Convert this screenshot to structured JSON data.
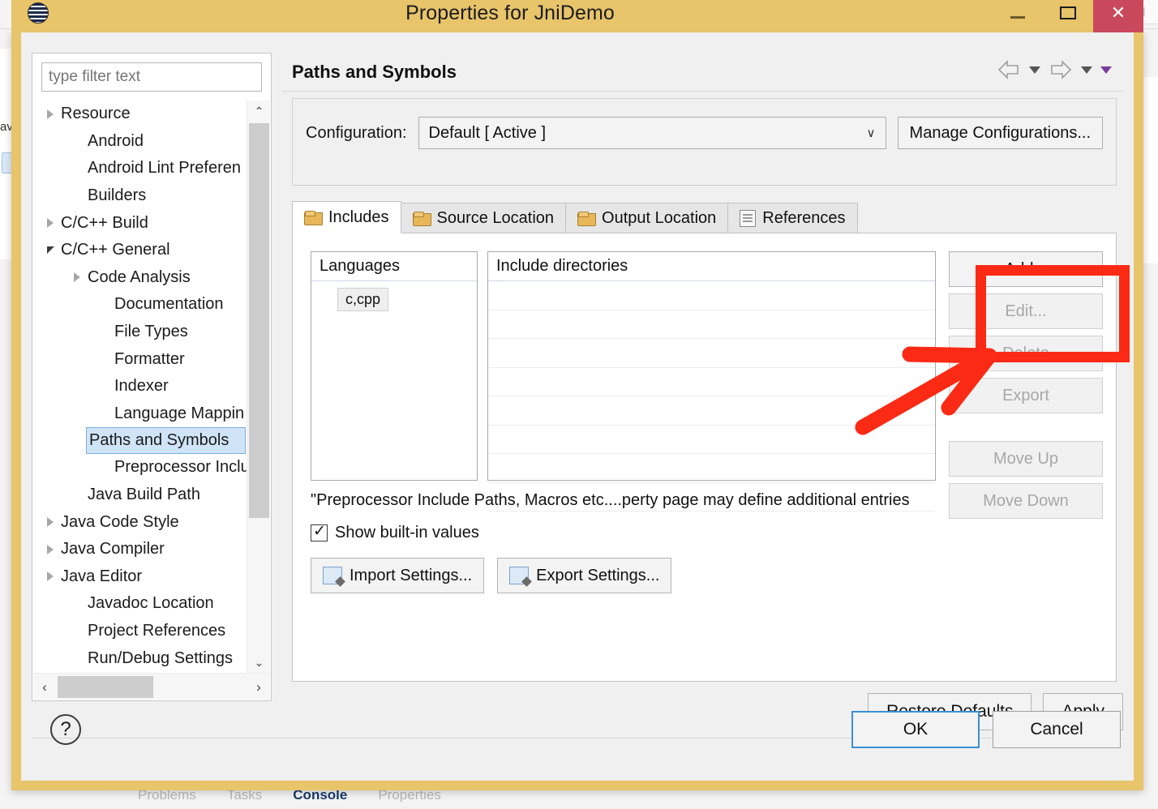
{
  "background": {
    "tool_icons": [
      "pen-icon",
      "chevron-down-icon",
      "device-icon",
      "add-perspective-icon"
    ],
    "left_tab_text": "av",
    "bottom_tabs": [
      {
        "label": "Problems",
        "icon": "problems-icon",
        "active": false
      },
      {
        "label": "Tasks",
        "icon": "tasks-icon",
        "active": false
      },
      {
        "label": "Console",
        "icon": "console-icon",
        "active": true,
        "suffix": "×"
      },
      {
        "label": "Properties",
        "icon": "properties-icon",
        "active": false
      }
    ]
  },
  "window": {
    "title": "Properties for JniDemo",
    "icon": "eclipse-icon",
    "minimize_label": "–",
    "maximize_label": "□",
    "close_label": "✕"
  },
  "sidebar": {
    "filter_placeholder": "type filter text",
    "filter_value": "",
    "items": [
      {
        "label": "Resource",
        "indent": 0,
        "twisty": "collapsed",
        "selected": false
      },
      {
        "label": "Android",
        "indent": 1,
        "twisty": "none",
        "selected": false
      },
      {
        "label": "Android Lint Preferen",
        "indent": 1,
        "twisty": "none",
        "selected": false
      },
      {
        "label": "Builders",
        "indent": 1,
        "twisty": "none",
        "selected": false
      },
      {
        "label": "C/C++ Build",
        "indent": 0,
        "twisty": "collapsed",
        "selected": false
      },
      {
        "label": "C/C++ General",
        "indent": 0,
        "twisty": "expanded",
        "selected": false
      },
      {
        "label": "Code Analysis",
        "indent": 1,
        "twisty": "collapsed",
        "selected": false
      },
      {
        "label": "Documentation",
        "indent": 2,
        "twisty": "none",
        "selected": false
      },
      {
        "label": "File Types",
        "indent": 2,
        "twisty": "none",
        "selected": false
      },
      {
        "label": "Formatter",
        "indent": 2,
        "twisty": "none",
        "selected": false
      },
      {
        "label": "Indexer",
        "indent": 2,
        "twisty": "none",
        "selected": false
      },
      {
        "label": "Language Mappin",
        "indent": 2,
        "twisty": "none",
        "selected": false
      },
      {
        "label": "Paths and Symbols",
        "indent": 2,
        "twisty": "none",
        "selected": true
      },
      {
        "label": "Preprocessor Inclu",
        "indent": 2,
        "twisty": "none",
        "selected": false
      },
      {
        "label": "Java Build Path",
        "indent": 1,
        "twisty": "none",
        "selected": false
      },
      {
        "label": "Java Code Style",
        "indent": 0,
        "twisty": "collapsed",
        "selected": false
      },
      {
        "label": "Java Compiler",
        "indent": 0,
        "twisty": "collapsed",
        "selected": false
      },
      {
        "label": "Java Editor",
        "indent": 0,
        "twisty": "collapsed",
        "selected": false
      },
      {
        "label": "Javadoc Location",
        "indent": 1,
        "twisty": "none",
        "selected": false
      },
      {
        "label": "Project References",
        "indent": 1,
        "twisty": "none",
        "selected": false
      },
      {
        "label": "Run/Debug Settings",
        "indent": 1,
        "twisty": "none",
        "selected": false
      }
    ],
    "scroll_up_glyph": "⌃",
    "scroll_down_glyph": "⌄",
    "scroll_left_glyph": "‹",
    "scroll_right_glyph": "›"
  },
  "page": {
    "title": "Paths and Symbols",
    "nav": {
      "back_icon": "back-arrow-icon",
      "back_menu_icon": "chevron-down-icon",
      "forward_icon": "forward-arrow-icon",
      "forward_menu_icon": "chevron-down-icon",
      "view_menu_icon": "view-menu-icon"
    }
  },
  "configuration": {
    "label": "Configuration:",
    "selected": "Default  [ Active ]",
    "caret": "∨",
    "manage_button": "Manage Configurations..."
  },
  "tabs": [
    {
      "label": "Includes",
      "icon": "includes-folder-icon",
      "active": true
    },
    {
      "label": "Source Location",
      "icon": "source-folder-icon",
      "active": false
    },
    {
      "label": "Output Location",
      "icon": "output-folder-icon",
      "active": false
    },
    {
      "label": "References",
      "icon": "references-doc-icon",
      "active": false
    }
  ],
  "includes_tab": {
    "languages_header": "Languages",
    "languages": [
      "c,cpp"
    ],
    "directories_header": "Include directories",
    "directories": [],
    "empty_row_count": 8,
    "side_buttons": [
      {
        "label": "Add...",
        "enabled": true
      },
      {
        "label": "Edit...",
        "enabled": false
      },
      {
        "label": "Delete",
        "enabled": false
      },
      {
        "label": "Export",
        "enabled": false
      },
      {
        "label": "Move Up",
        "enabled": false,
        "gap": true
      },
      {
        "label": "Move Down",
        "enabled": false
      }
    ],
    "note": "\"Preprocessor Include Paths, Macros etc....perty page may define additional entries",
    "checkbox": {
      "label": "Show built-in values",
      "checked": true
    },
    "import_button": "Import Settings...",
    "export_button": "Export Settings..."
  },
  "footer": {
    "restore_defaults": "Restore Defaults",
    "apply": "Apply",
    "help_glyph": "?",
    "ok": "OK",
    "cancel": "Cancel"
  },
  "annotation": {
    "highlight_target": "Add...",
    "color": "#fb2a14",
    "shapes": [
      "rectangle",
      "arrow"
    ]
  }
}
